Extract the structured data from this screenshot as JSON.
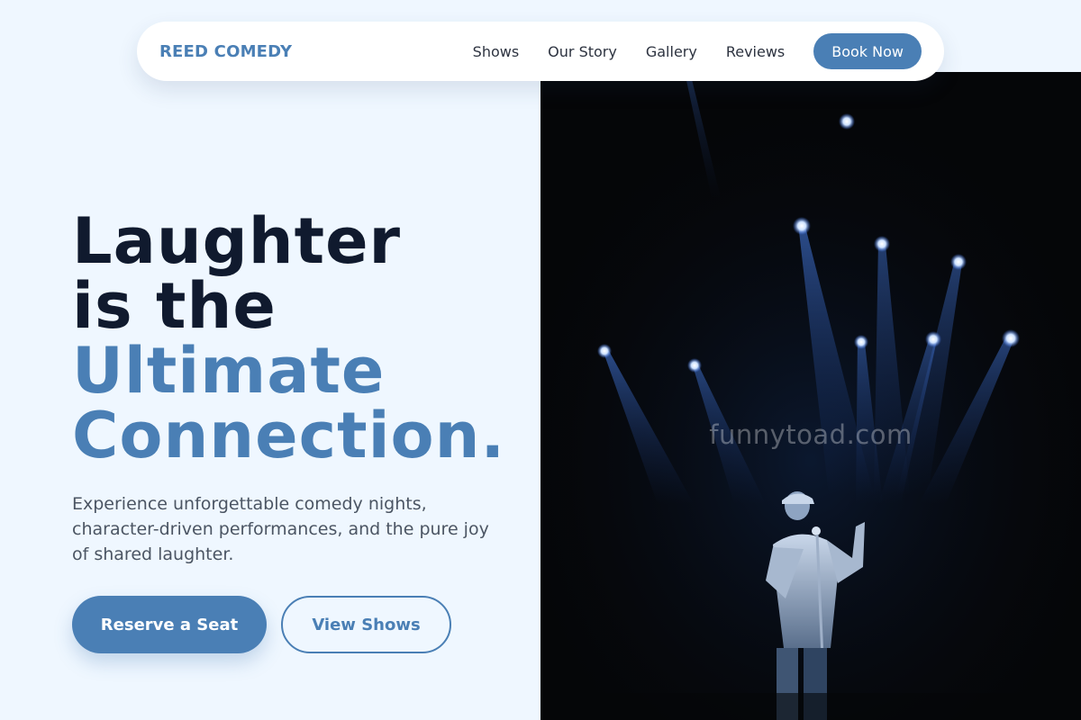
{
  "nav": {
    "brand": "REED COMEDY",
    "links": [
      {
        "label": "Shows"
      },
      {
        "label": "Our Story"
      },
      {
        "label": "Gallery"
      },
      {
        "label": "Reviews"
      }
    ],
    "cta_label": "Book Now"
  },
  "hero": {
    "headline_line1": "Laughter",
    "headline_line2": "is the",
    "headline_line3": "Ultimate",
    "headline_line4": "Connection.",
    "lead": "Experience unforgettable comedy nights, character-driven performances, and the pure joy of shared laughter.",
    "primary_button": "Reserve a Seat",
    "secondary_button": "View Shows",
    "image_watermark": "funnytoad.com",
    "image_alt": "comedian-on-stage-photo"
  },
  "colors": {
    "background": "#eff7ff",
    "accent": "#4a7fb5",
    "heading": "#101a2e",
    "body_text": "#4b5563"
  }
}
